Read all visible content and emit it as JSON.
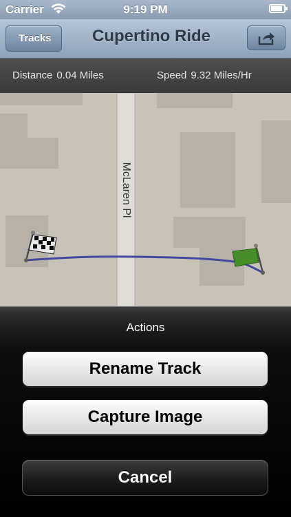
{
  "status_bar": {
    "carrier": "Carrier",
    "time": "9:19 PM"
  },
  "nav": {
    "back_label": "Tracks",
    "title": "Cupertino Ride",
    "share_icon": "share-icon"
  },
  "info": {
    "distance_label": "Distance",
    "distance_value": "0.04 Miles",
    "speed_label": "Speed",
    "speed_value": "9.32 Miles/Hr"
  },
  "map": {
    "street_name": "McLaren Pl",
    "route_color": "#4b4fa8",
    "start_icon": "checkered-flag-icon",
    "end_icon": "green-flag-icon"
  },
  "action_sheet": {
    "title": "Actions",
    "buttons": [
      {
        "label": "Rename Track"
      },
      {
        "label": "Capture Image"
      },
      {
        "label": "Cancel"
      }
    ]
  }
}
